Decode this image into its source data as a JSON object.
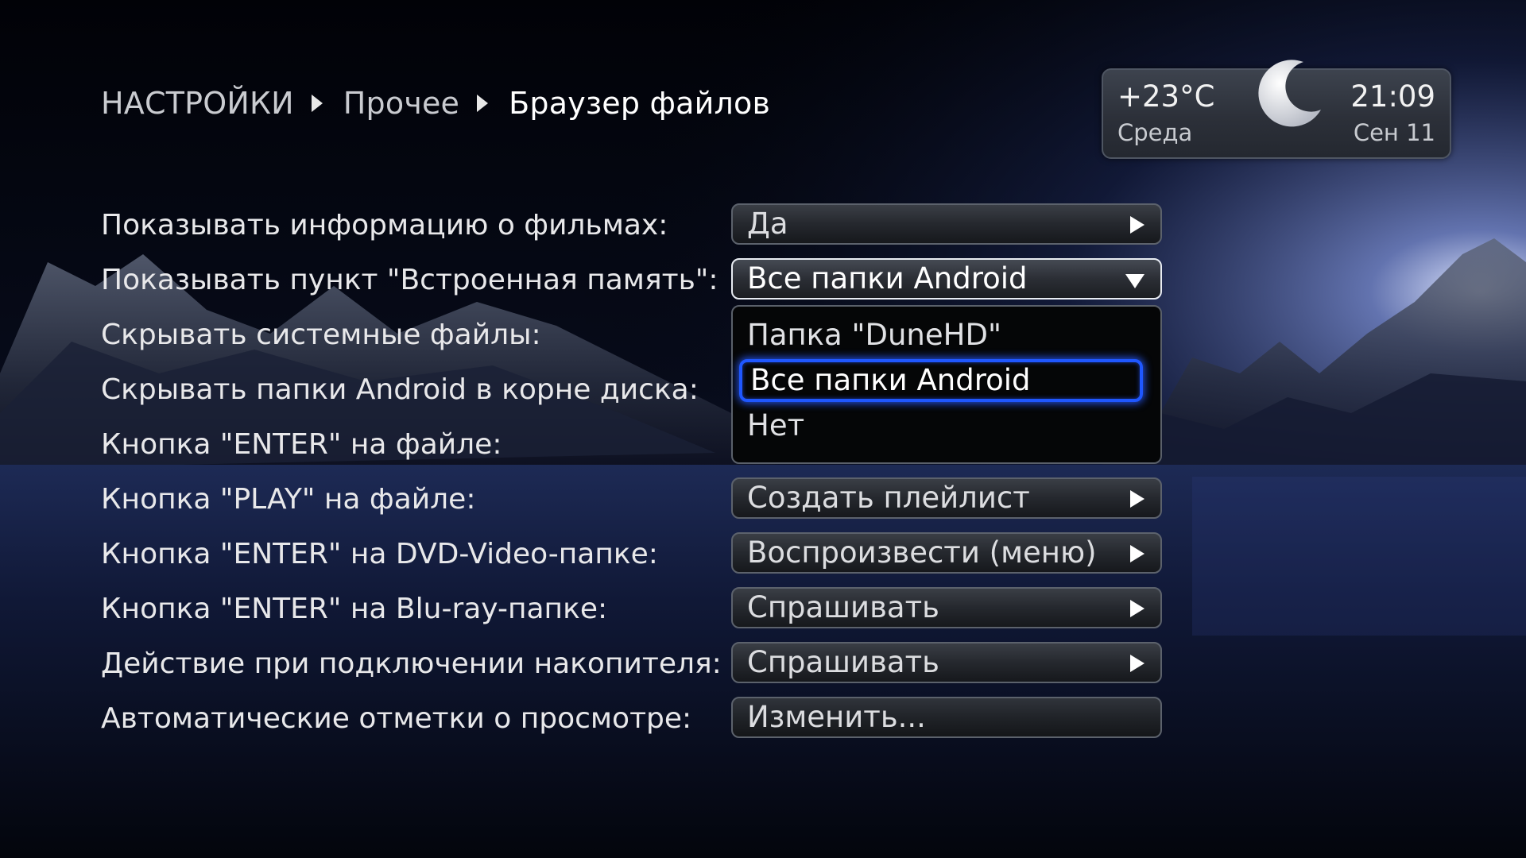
{
  "breadcrumb": {
    "items": [
      "НАСТРОЙКИ",
      "Прочее",
      "Браузер файлов"
    ]
  },
  "widget": {
    "temperature": "+23°C",
    "time": "21:09",
    "day": "Среда",
    "date": "Сен 11",
    "weather_icon": "moon-icon"
  },
  "settings": {
    "rows": [
      {
        "label": "Показывать информацию о фильмах:",
        "value": "Да",
        "control": "arrow-right"
      },
      {
        "label": "Показывать пункт \"Встроенная память\":",
        "value": "Все папки Android",
        "control": "dropdown-open"
      },
      {
        "label": "Скрывать системные файлы:"
      },
      {
        "label": "Скрывать папки Android в корне диска:"
      },
      {
        "label": "Кнопка \"ENTER\" на файле:"
      },
      {
        "label": "Кнопка \"PLAY\" на файле:",
        "value": "Создать плейлист",
        "control": "arrow-right"
      },
      {
        "label": "Кнопка \"ENTER\" на DVD-Video-папке:",
        "value": "Воспроизвести (меню)",
        "control": "arrow-right"
      },
      {
        "label": "Кнопка \"ENTER\" на Blu-ray-папке:",
        "value": "Спрашивать",
        "control": "arrow-right"
      },
      {
        "label": "Действие при подключении накопителя:",
        "value": "Спрашивать",
        "control": "arrow-right"
      },
      {
        "label": "Автоматические отметки о просмотре:",
        "value": "Изменить...",
        "control": "button"
      }
    ]
  },
  "dropdown": {
    "options": [
      "Папка \"DuneHD\"",
      "Все папки Android",
      "Нет"
    ],
    "selected_index": 1
  },
  "colors": {
    "highlight": "#1f57ff",
    "field_border": "#5c626c",
    "text": "#e8e8ea"
  }
}
